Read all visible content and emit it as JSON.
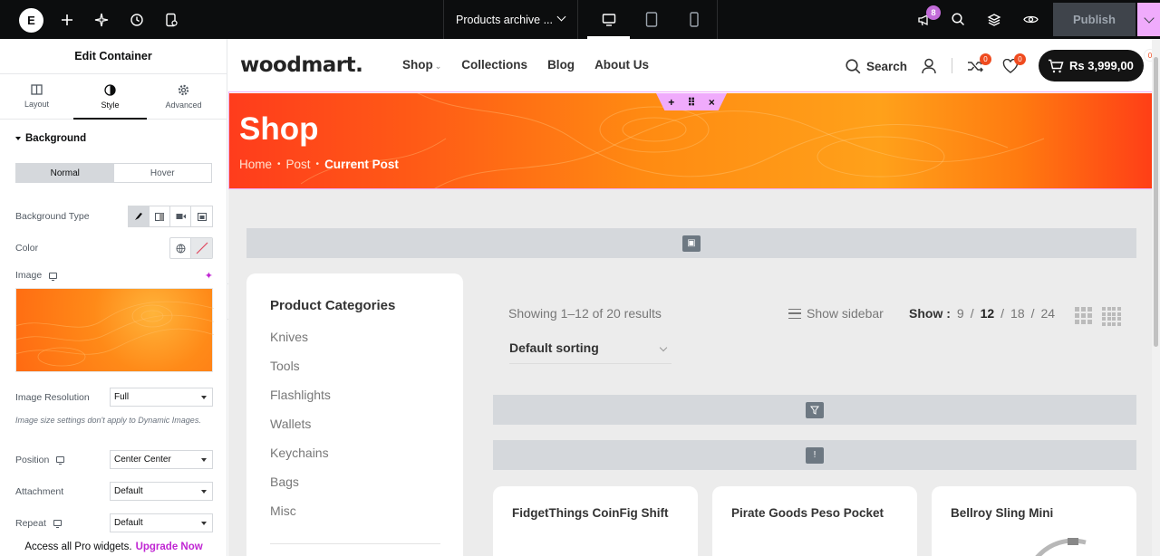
{
  "topbar": {
    "document_name": "Products archive ...",
    "notifications_count": "8",
    "publish_label": "Publish"
  },
  "panel": {
    "title": "Edit Container",
    "tabs": [
      {
        "label": "Layout",
        "icon": "layout-icon"
      },
      {
        "label": "Style",
        "icon": "half-circle-icon",
        "active": true
      },
      {
        "label": "Advanced",
        "icon": "gear-icon"
      }
    ],
    "section_title": "Background",
    "state_toggle": {
      "normal": "Normal",
      "hover": "Hover",
      "active": "Normal"
    },
    "background_type_label": "Background Type",
    "color_label": "Color",
    "image_label": "Image",
    "image_resolution_label": "Image Resolution",
    "image_resolution_value": "Full",
    "hint": "Image size settings don't apply to Dynamic Images.",
    "position_label": "Position",
    "position_value": "Center Center",
    "attachment_label": "Attachment",
    "attachment_value": "Default",
    "repeat_label": "Repeat",
    "repeat_value": "Default",
    "footer_text": "Access all Pro widgets.",
    "footer_link": "Upgrade Now"
  },
  "site": {
    "logo": "woodmart.",
    "nav": [
      "Shop",
      "Collections",
      "Blog",
      "About Us"
    ],
    "search_label": "Search",
    "compare_count": "0",
    "wishlist_count": "0",
    "cart_total": "Rs 3,999,00",
    "cart_count": "0",
    "hero_title": "Shop",
    "breadcrumbs": [
      "Home",
      "Post",
      "Current Post"
    ],
    "sidebar": {
      "title": "Product Categories",
      "categories": [
        "Knives",
        "Tools",
        "Flashlights",
        "Wallets",
        "Keychains",
        "Bags",
        "Misc"
      ]
    },
    "results_text": "Showing 1–12 of 20 results",
    "show_sidebar": "Show sidebar",
    "show_label": "Show :",
    "show_options": [
      "9",
      "12",
      "18",
      "24"
    ],
    "show_selected": "12",
    "sorting": "Default sorting",
    "products": [
      "FidgetThings CoinFig Shift",
      "Pirate Goods Peso Pocket",
      "Bellroy Sling Mini"
    ]
  },
  "colors": {
    "accent_pink": "#f0abfc",
    "hero_orange": "#ff8b12",
    "badge_red": "#ef4b1f"
  }
}
